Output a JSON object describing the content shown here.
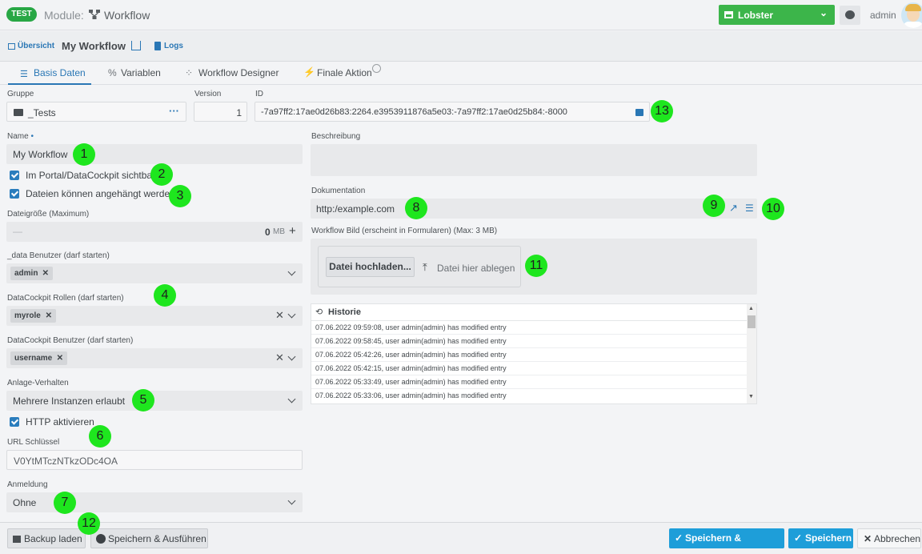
{
  "topbar": {
    "env_badge": "TEST",
    "module_label": "Module:",
    "module_name": "Workflow",
    "tenant": "Lobster",
    "user": "admin"
  },
  "subbar": {
    "overview": "Übersicht",
    "title": "My Workflow",
    "logs": "Logs"
  },
  "tabs": [
    {
      "label": "Basis Daten",
      "active": true
    },
    {
      "label": "Variablen"
    },
    {
      "label": "Workflow Designer"
    },
    {
      "label": "Finale Aktion"
    }
  ],
  "form": {
    "group_label": "Gruppe",
    "group_value": "_Tests",
    "version_label": "Version",
    "version_value": "1",
    "id_label": "ID",
    "id_value": "-7a97ff2:17ae0d26b83:2264.e3953911876a5e03:-7a97ff2:17ae0d25b84:-8000",
    "name_label": "Name",
    "name_required": "•",
    "name_value": "My Workflow",
    "portal_visible": "Im Portal/DataCockpit sichtbar",
    "attachments": "Dateien können angehängt werden",
    "filesize_label": "Dateigröße (Maximum)",
    "filesize_dash": "—",
    "filesize_value": "0",
    "filesize_unit": "MB",
    "filesize_plus": "+",
    "data_users_label": "_data Benutzer (darf starten)",
    "data_users_chip": "admin",
    "dc_roles_label": "DataCockpit Rollen (darf starten)",
    "dc_roles_chip": "myrole",
    "dc_users_label": "DataCockpit Benutzer (darf starten)",
    "dc_users_chip": "username",
    "behavior_label": "Anlage-Verhalten",
    "behavior_value": "Mehrere Instanzen erlaubt",
    "http_label": "HTTP aktivieren",
    "url_key_label": "URL Schlüssel",
    "url_key_value": "V0YtMTczNTkzODc4OA",
    "login_label": "Anmeldung",
    "login_value": "Ohne",
    "description_label": "Beschreibung",
    "documentation_label": "Dokumentation",
    "documentation_value": "http:/example.com",
    "image_label": "Workflow Bild (erscheint in Formularen) (Max: 3 MB)",
    "upload_button": "Datei hochladen...",
    "drop_text": "Datei hier ablegen"
  },
  "history": {
    "title": "Historie",
    "rows": [
      "07.06.2022 09:59:08, user admin(admin) has modified entry",
      "07.06.2022 09:58:45, user admin(admin) has modified entry",
      "07.06.2022 05:42:26, user admin(admin) has modified entry",
      "07.06.2022 05:42:15, user admin(admin) has modified entry",
      "07.06.2022 05:33:49, user admin(admin) has modified entry",
      "07.06.2022 05:33:06, user admin(admin) has modified entry"
    ]
  },
  "footer": {
    "backup": "Backup laden",
    "save_run": "Speichern & Ausführen",
    "save_close": "Speichern & Schließen",
    "save": "Speichern",
    "cancel": "Abbrechen"
  },
  "markers": [
    "1",
    "2",
    "3",
    "4",
    "5",
    "6",
    "7",
    "8",
    "9",
    "10",
    "11",
    "12",
    "13"
  ],
  "colors": {
    "accent": "#2a77b5",
    "success": "#28a745",
    "marker": "#1ee61e",
    "primary_button": "#1e9ed9"
  }
}
